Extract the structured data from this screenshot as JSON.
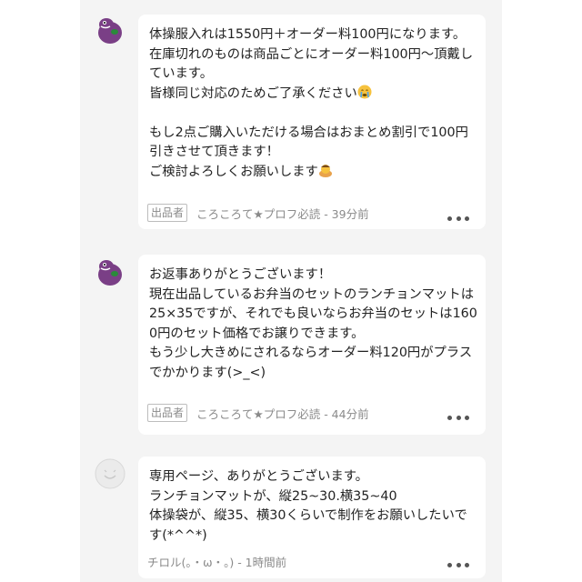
{
  "messages": [
    {
      "avatar": "purple-dinosaur-avatar",
      "text": "体操服入れは1550円＋オーダー料100円になります。\n在庫切れのものは商品ごとにオーダー料100円〜頂戴しています。\n皆様同じ対応のためご了承ください",
      "text2": "\n\nもし2点ご購入いただける場合はおまとめ割引で100円引きさせて頂きます！\nご検討よろしくお願いします",
      "seller_badge": "出品者",
      "author_time": "ころころて★プロフ必読 - 39分前"
    },
    {
      "avatar": "purple-dinosaur-avatar",
      "text": "お返事ありがとうございます！\n現在出品しているお弁当のセットのランチョンマットは25×35ですが、それでも良いならお弁当のセットは1600円のセット価格でお譲りできます。\nもう少し大きめにされるならオーダー料120円がプラスでかかります(>_<)",
      "seller_badge": "出品者",
      "author_time": "ころころて★プロフ必読 - 44分前"
    },
    {
      "avatar": "default-smiley-avatar",
      "text": "専用ページ、ありがとうございます。\nランチョンマットが、縦25~30.横35~40\n体操袋が、縦35、横30くらいで制作をお願いしたいです(*^^*)",
      "author_time": "チロル(。・ω・。) - 1時間前"
    }
  ],
  "icons": {
    "crying": "crying-face-icon",
    "bowing": "bowing-person-icon",
    "more": "more-horizontal-icon"
  },
  "colors": {
    "panel_bg": "#f4f4f4",
    "bubble_bg": "#ffffff",
    "text": "#222222",
    "meta": "#8a8a8a",
    "avatar_purple": "#7a3f86"
  }
}
